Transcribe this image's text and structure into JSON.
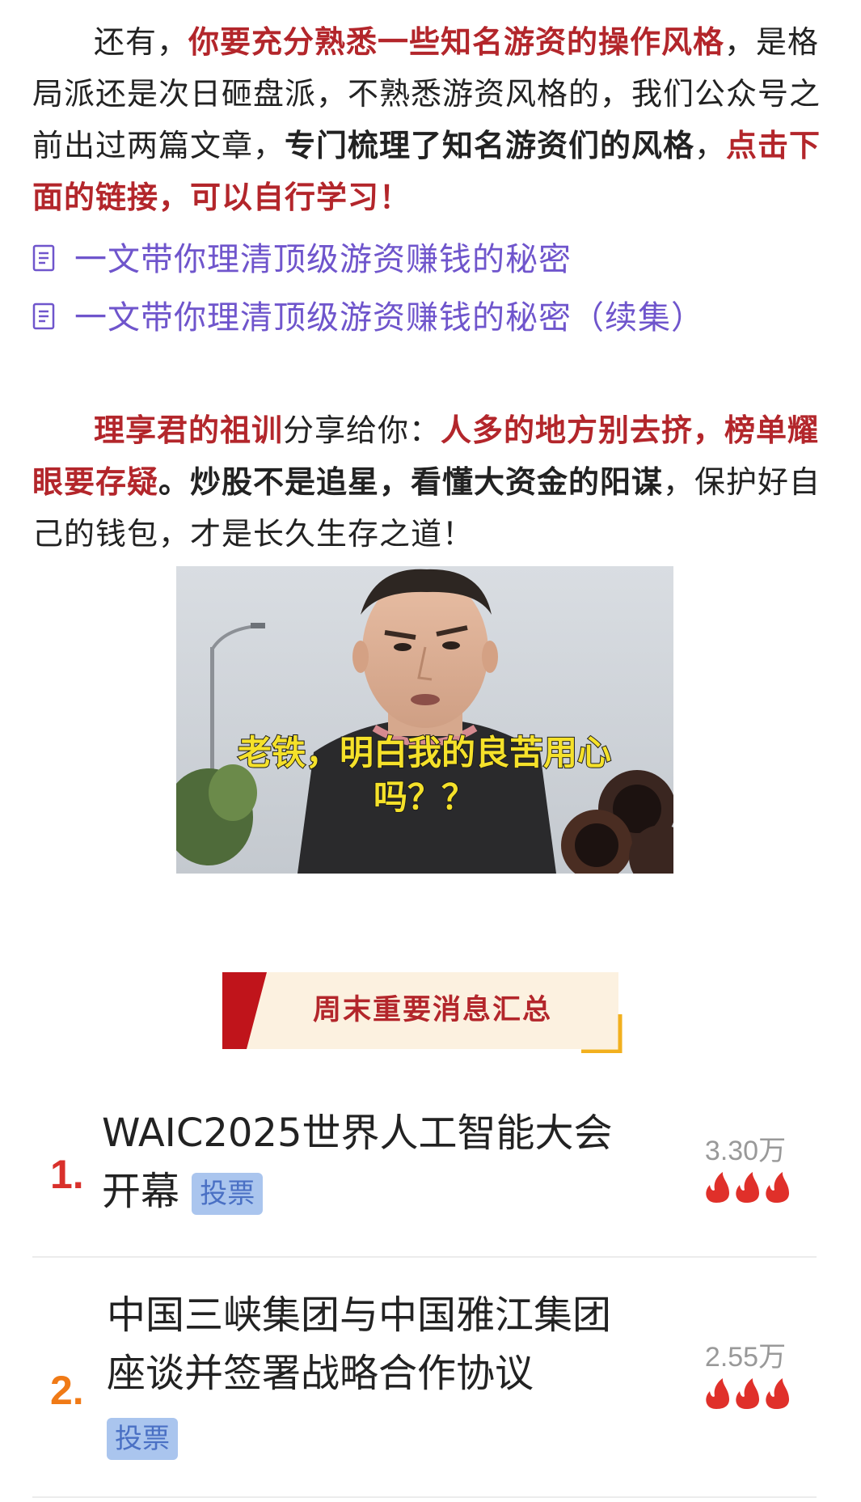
{
  "intro": {
    "p1": "还有，",
    "p2": "你要充分熟悉一些知名游资的操作风格",
    "p3": "，是格局派还是次日砸盘派，不熟悉游资风格的，我们公众号之前出过两篇文章，",
    "p4": "专门梳理了知名游资们的风格",
    "p5": "，",
    "p6": "点击下面的链接，可以自行学习！"
  },
  "links": [
    {
      "label": "一文带你理清顶级游资赚钱的秘密",
      "icon": "document-icon"
    },
    {
      "label": "一文带你理清顶级游资赚钱的秘密（续集）",
      "icon": "document-icon"
    }
  ],
  "motto": {
    "a": "理享君的祖训",
    "b": "分享给你：",
    "c": "人多的地方别去挤，榜单耀眼要存疑",
    "d": "。炒股不是追星，看懂大资金的阳谋",
    "e": "，保护好自己的钱包，才是长久生存之道！"
  },
  "meme": {
    "caption_line1": "老铁，明白我的良苦用心",
    "caption_line2": "吗？？"
  },
  "section_banner": "周末重要消息汇总",
  "news": [
    {
      "rank": "1.",
      "rank_color": "#d9302b",
      "title_line1": "WAIC2025世界人工智能大会",
      "title_line2": "开幕",
      "badge": "投票",
      "count": "3.30万"
    },
    {
      "rank": "2.",
      "rank_color": "#f07a16",
      "title_line1": "中国三峡集团与中国雅江集团",
      "title_line2": "座谈并签署战略合作协议",
      "badge": "投票",
      "count": "2.55万"
    }
  ],
  "colors": {
    "accent_red": "#b3262b",
    "link_purple": "#6f55cc",
    "flame_red": "#e0302a"
  }
}
